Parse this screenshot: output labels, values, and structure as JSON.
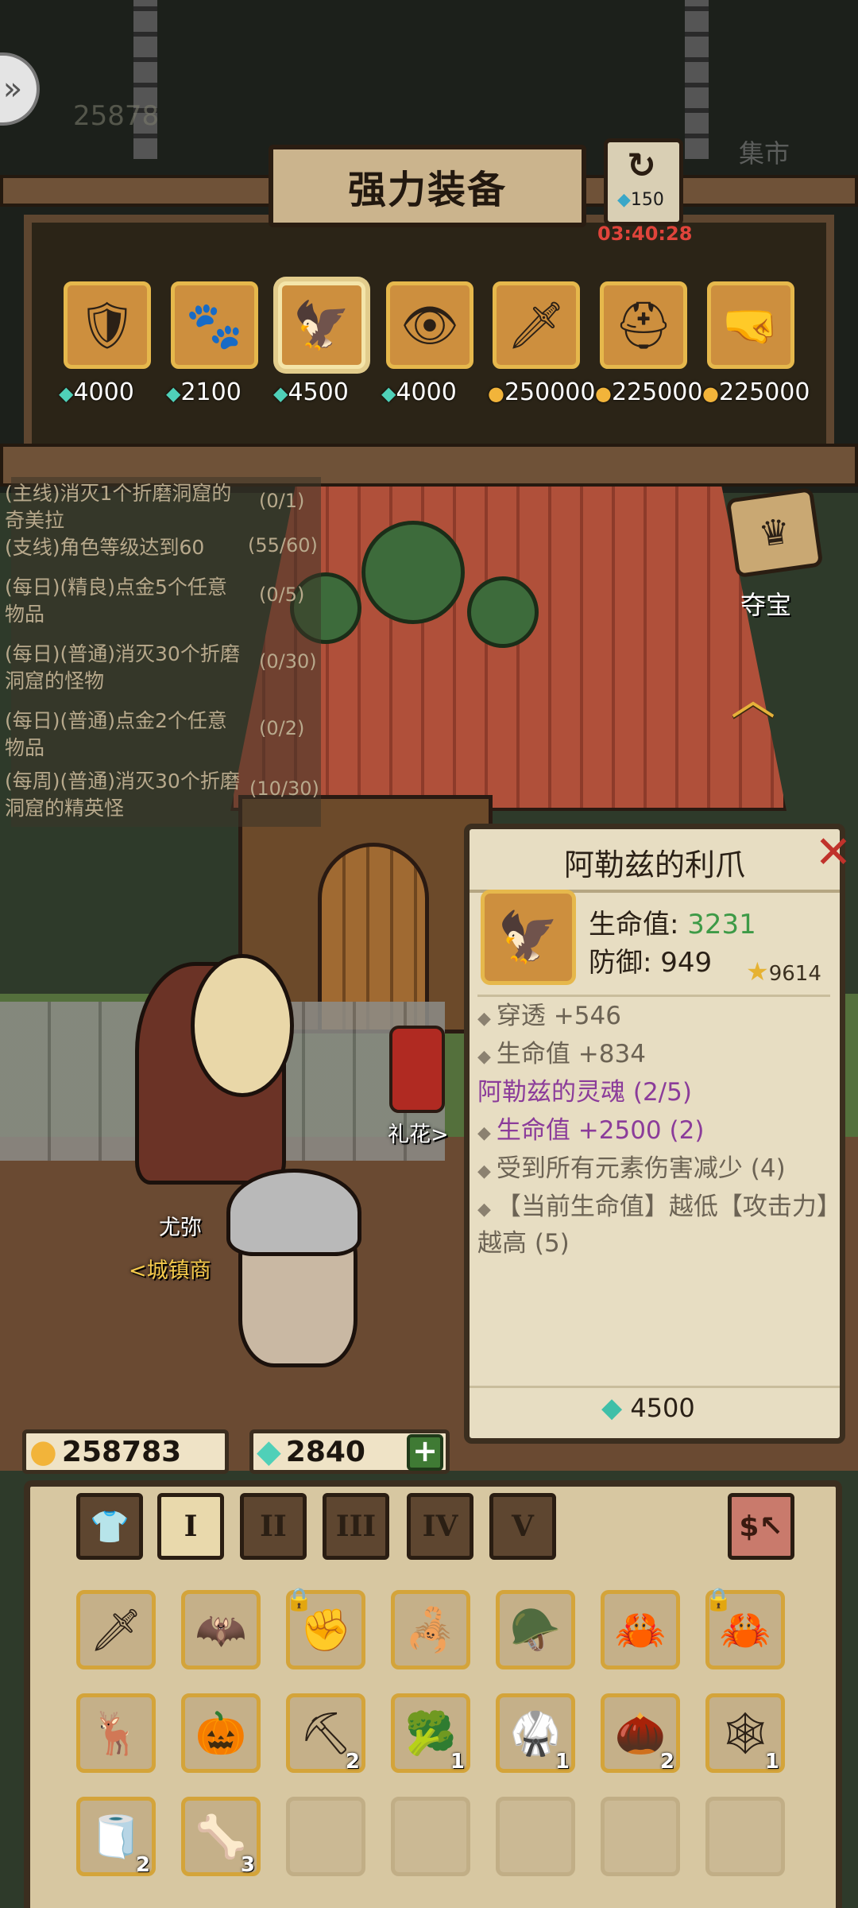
{
  "top": {
    "back_icon": "double-chevron-icon",
    "ghost_counter": "25878",
    "market_label": "集市"
  },
  "shop": {
    "title": "强力装备",
    "refresh_cost": "150",
    "refresh_timer": "03:40:28",
    "items": [
      {
        "icon": "black-chest-armor-icon",
        "currency": "gem",
        "price": "4000"
      },
      {
        "icon": "brown-fur-gauntlet-icon",
        "currency": "gem",
        "price": "2100"
      },
      {
        "icon": "alez-claw-icon",
        "currency": "gem",
        "price": "4500",
        "selected": true
      },
      {
        "icon": "red-eye-helm-icon",
        "currency": "gem",
        "price": "4000"
      },
      {
        "icon": "flame-sword-icon",
        "currency": "gold",
        "price": "250000"
      },
      {
        "icon": "knight-helm-icon",
        "currency": "gold",
        "price": "225000"
      },
      {
        "icon": "gold-gauntlet-icon",
        "currency": "gold",
        "price": "225000"
      }
    ]
  },
  "quests": [
    {
      "text": "(主线)消灭1个折磨洞窟的奇美拉",
      "progress": "(0/1)"
    },
    {
      "text": "(支线)角色等级达到60",
      "progress": "(55/60)"
    },
    {
      "text": "(每日)(精良)点金5个任意物品",
      "progress": "(0/5)"
    },
    {
      "text": "(每日)(普通)消灭30个折磨洞窟的怪物",
      "progress": "(0/30)"
    },
    {
      "text": "(每日)(普通)点金2个任意物品",
      "progress": "(0/2)"
    },
    {
      "text": "(每周)(普通)消灭30个折磨洞窟的精英怪",
      "progress": "(10/30)"
    }
  ],
  "side": {
    "treasure_label": "夺宝"
  },
  "scene": {
    "npc_name": "尤弥",
    "npc_title": "<城镇商",
    "lantern_label": "礼花>"
  },
  "popup": {
    "title": "阿勒兹的利爪",
    "hp_label": "生命值:",
    "hp_value": "3231",
    "def_label": "防御:",
    "def_value": "949",
    "power": "9614",
    "bonus_1": "穿透 +546",
    "bonus_2": "生命值 +834",
    "set_name": "阿勒兹的灵魂 (2/5)",
    "set_1": "生命值 +2500 (2)",
    "set_2": "受到所有元素伤害减少 (4)",
    "set_3": "【当前生命值】越低【攻击力】越高 (5)",
    "price": "4500"
  },
  "currency": {
    "gold": "258783",
    "gems": "2840"
  },
  "inventory": {
    "tabs": [
      "I",
      "II",
      "III",
      "IV",
      "V"
    ],
    "slots": [
      {
        "icon": "flame-sword-icon",
        "count": ""
      },
      {
        "icon": "dark-armor-icon",
        "count": ""
      },
      {
        "icon": "purple-gauntlet-icon",
        "count": "",
        "locked": true
      },
      {
        "icon": "spiked-shoulder-icon",
        "count": ""
      },
      {
        "icon": "silver-helm-icon",
        "count": ""
      },
      {
        "icon": "red-claw-icon",
        "count": ""
      },
      {
        "icon": "red-claw-icon",
        "count": "",
        "locked": true
      },
      {
        "icon": "antler-icon",
        "count": ""
      },
      {
        "icon": "pumpkin-icon",
        "count": ""
      },
      {
        "icon": "shovel-icon",
        "count": "2"
      },
      {
        "icon": "herb-icon",
        "count": "1"
      },
      {
        "icon": "steel-armor-icon",
        "count": "1"
      },
      {
        "icon": "seeds-icon",
        "count": "2"
      },
      {
        "icon": "spider-web-icon",
        "count": "1"
      },
      {
        "icon": "bandage-icon",
        "count": "2"
      },
      {
        "icon": "blue-bone-icon",
        "count": "3"
      }
    ]
  },
  "colors": {
    "accent_gold": "#f2b43a",
    "accent_gem": "#4fd0b8",
    "hp_green": "#3d9a46",
    "set_purple": "#8b3c9a",
    "timer_red": "#e0443b"
  }
}
